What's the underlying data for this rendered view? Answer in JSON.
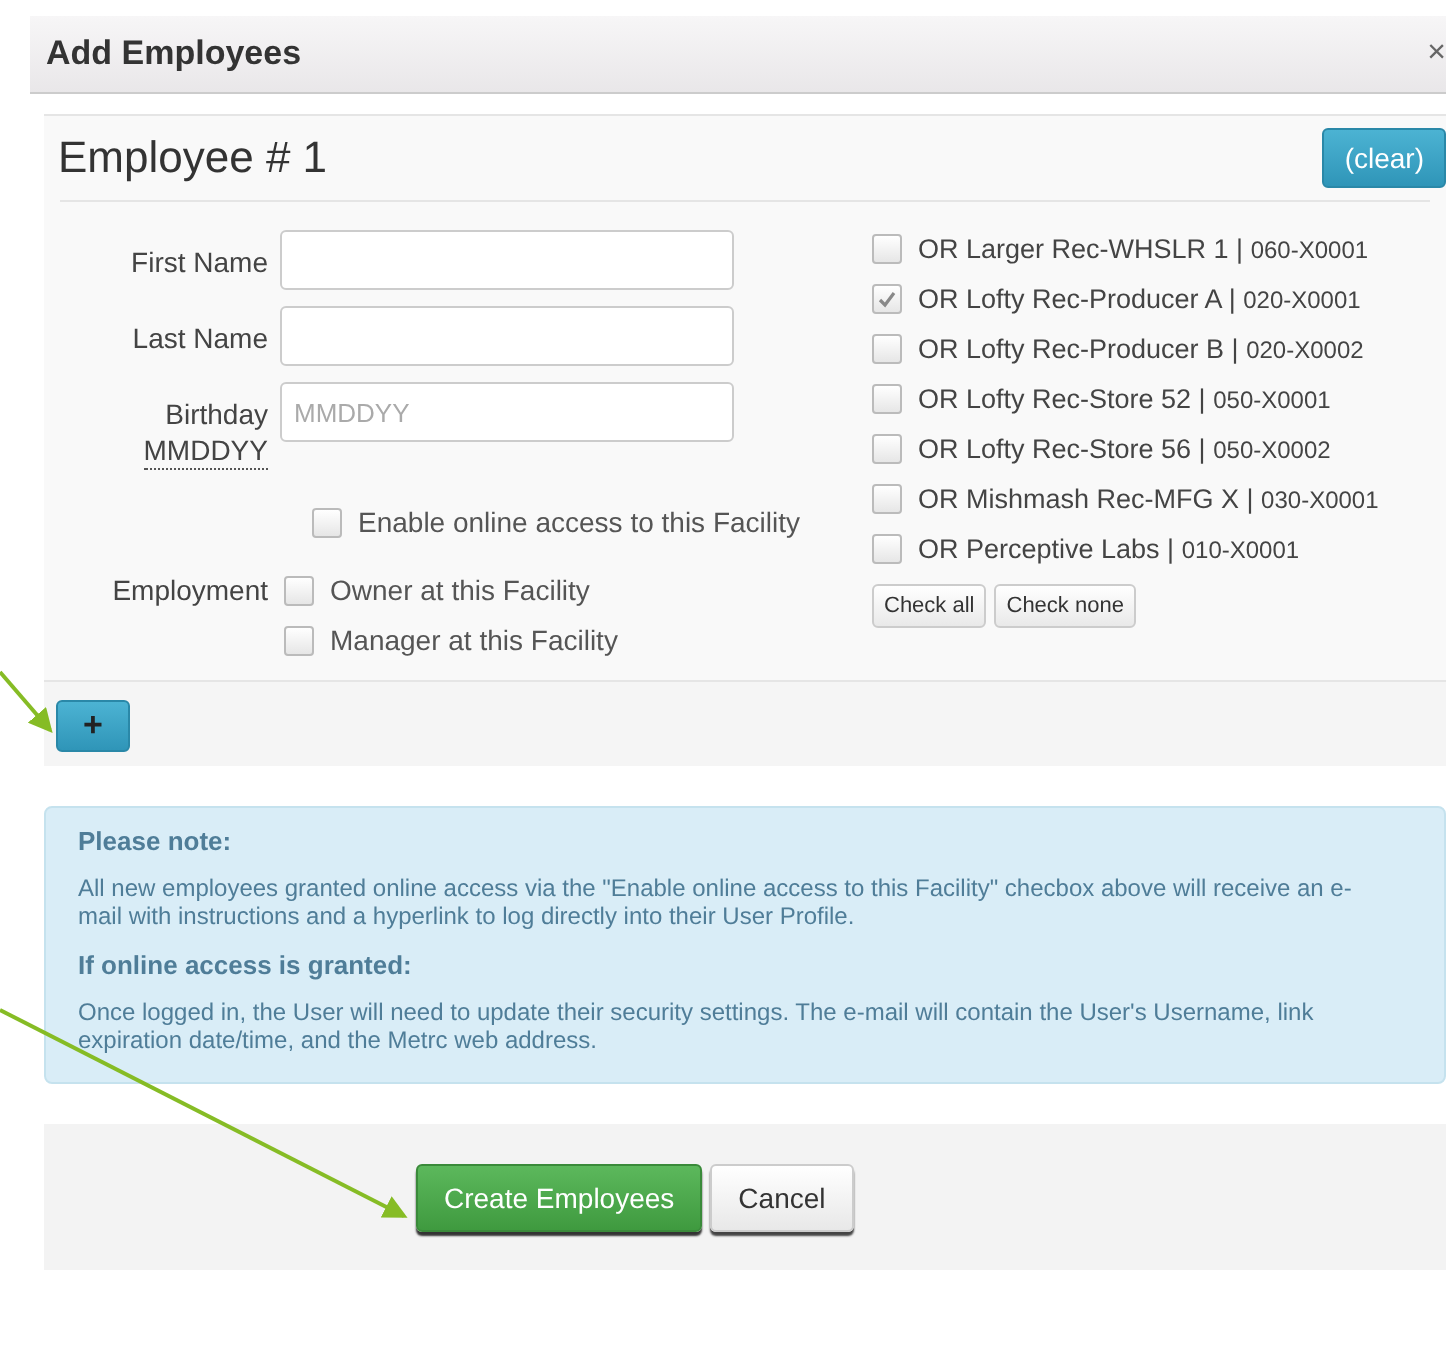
{
  "dialog": {
    "title": "Add Employees",
    "close": "×"
  },
  "employee": {
    "heading": "Employee # 1",
    "clear_button": "(clear)",
    "fields": [
      {
        "label": "First Name"
      },
      {
        "label": "Last Name"
      },
      {
        "label": "Birthday",
        "sublabel": "MMDDYY",
        "placeholder": "MMDDYY"
      }
    ],
    "online_access": {
      "label": "Enable online access to this Facility",
      "checked": false
    },
    "employment": {
      "label": "Employment",
      "options": [
        {
          "label": "Owner at this Facility",
          "checked": false
        },
        {
          "label": "Manager at this Facility",
          "checked": false
        }
      ]
    },
    "facilities": [
      {
        "name": "OR Larger Rec-WHSLR 1 |",
        "license": "060-X0001",
        "checked": false
      },
      {
        "name": "OR Lofty Rec-Producer A |",
        "license": "020-X0001",
        "checked": true
      },
      {
        "name": "OR Lofty Rec-Producer B |",
        "license": "020-X0002",
        "checked": false
      },
      {
        "name": "OR Lofty Rec-Store 52 |",
        "license": "050-X0001",
        "checked": false
      },
      {
        "name": "OR Lofty Rec-Store 56 |",
        "license": "050-X0002",
        "checked": false
      },
      {
        "name": "OR Mishmash Rec-MFG X |",
        "license": "030-X0001",
        "checked": false
      },
      {
        "name": "OR Perceptive Labs |",
        "license": "010-X0001",
        "checked": false
      }
    ],
    "check_all": "Check all",
    "check_none": "Check none"
  },
  "add_button": "+",
  "note": {
    "heading": "Please note:",
    "text": "All new employees granted online access via the \"Enable online access to this Facility\" checbox above will receive an e-mail with instructions and a hyperlink to log directly into their User Profile.",
    "subheading": "If online access is granted:",
    "text2": "Once logged in, the User will need to update their security settings. The e-mail will contain the User's Username, link expiration date/time, and the Metrc web address."
  },
  "buttons": [
    {
      "label": "Create Employees",
      "kind": "primary"
    },
    {
      "label": "Cancel",
      "kind": "default"
    }
  ]
}
